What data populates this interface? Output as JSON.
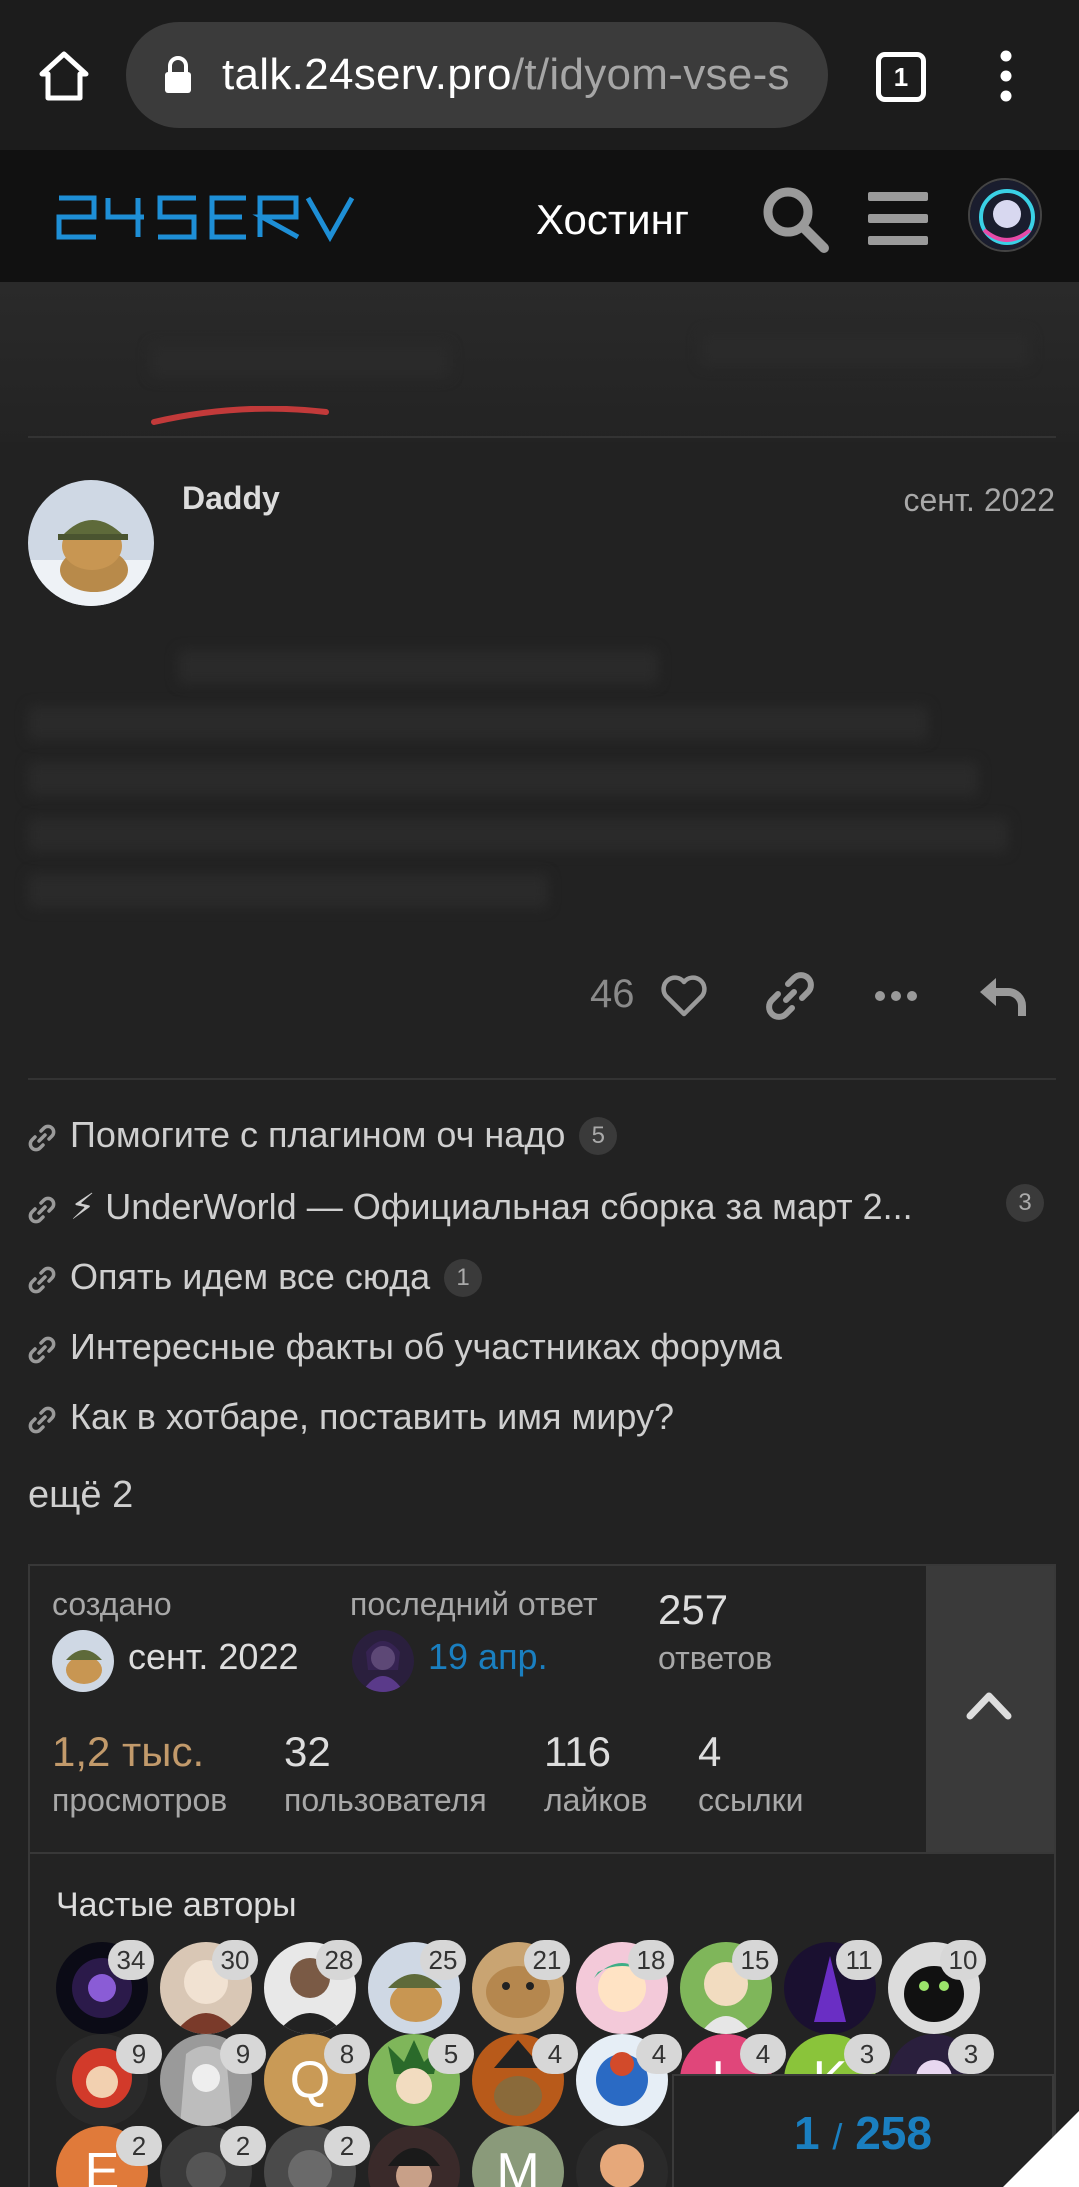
{
  "browser": {
    "url_domain": "talk.24serv.pro",
    "url_path": "/t/idyom-vse-s",
    "tab_count": "1"
  },
  "header": {
    "logo_text": "24SERV",
    "nav_hosting": "Хостинг"
  },
  "post": {
    "author": "Daddy",
    "date": "сент. 2022",
    "like_count": "46"
  },
  "linked_topics": [
    {
      "title": "Помогите с плагином оч надо",
      "count": "5"
    },
    {
      "title": "⚡ UnderWorld — Официальная сборка за март 2...",
      "count": "3"
    },
    {
      "title": "Опять идем все сюда",
      "count": "1"
    },
    {
      "title": "Интересные факты об участниках форума",
      "count": ""
    },
    {
      "title": "Как в хотбаре, поставить имя миру?",
      "count": ""
    }
  ],
  "more_link": "ещё 2",
  "topic_map": {
    "created_label": "создано",
    "created_date": "сент. 2022",
    "last_reply_label": "последний ответ",
    "last_reply_date": "19 апр.",
    "replies_num": "257",
    "replies_label": "ответов",
    "views_num": "1,2 тыс.",
    "views_label": "просмотров",
    "users_num": "32",
    "users_label": "пользователя",
    "likes_num": "116",
    "likes_label": "лайков",
    "links_num": "4",
    "links_label": "ссылки",
    "frequent_authors_title": "Частые авторы",
    "authors_row1": [
      "34",
      "30",
      "28",
      "25",
      "21",
      "18",
      "15",
      "11",
      "10"
    ],
    "authors_row2": [
      "9",
      "9",
      "8",
      "5",
      "4",
      "4",
      "4",
      "3",
      "3"
    ],
    "authors_row3": [
      "2",
      "2",
      "2",
      "",
      "",
      ""
    ],
    "letters": {
      "q": "Q",
      "l": "L",
      "k": "K",
      "e": "E",
      "m": "M"
    }
  },
  "progress": {
    "current": "1",
    "separator": "/",
    "total": "258"
  },
  "colors": {
    "accent_blue": "#1a7fc0",
    "views_highlight": "#c29a6b",
    "brand_logo": "#1e8fd6"
  }
}
